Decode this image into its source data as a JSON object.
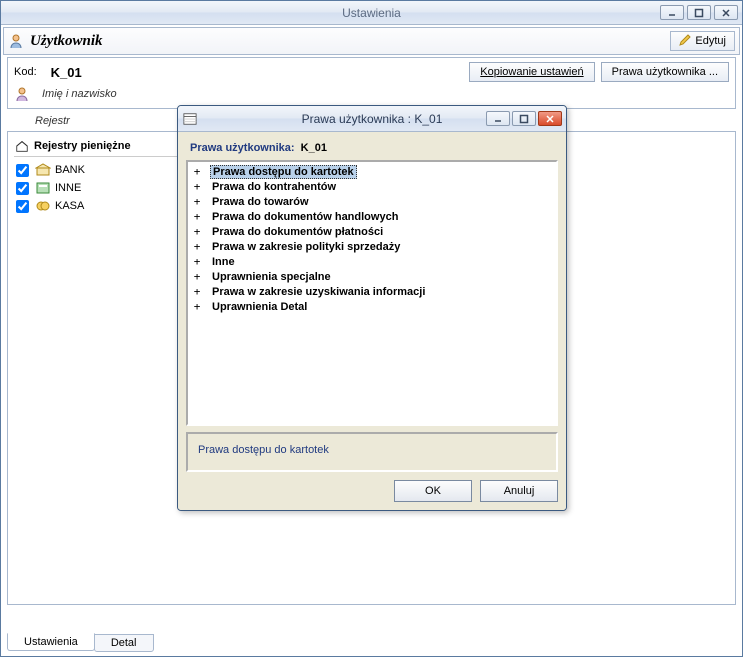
{
  "main": {
    "title": "Ustawienia",
    "user_section_label": "Użytkownik",
    "edit_button": "Edytuj"
  },
  "info": {
    "code_label": "Kod:",
    "code_value": "K_01",
    "fullname_label": "Imię i nazwisko",
    "copy_settings_button": "Kopiowanie ustawień",
    "user_rights_button": "Prawa użytkownika ..."
  },
  "registries": {
    "link_label": "Rejestr",
    "group_title": "Rejestry pieniężne",
    "items": [
      {
        "label": "BANK",
        "checked": true,
        "icon": "bank-icon"
      },
      {
        "label": "INNE",
        "checked": true,
        "icon": "other-icon"
      },
      {
        "label": "KASA",
        "checked": true,
        "icon": "cash-icon"
      }
    ]
  },
  "tabs": {
    "active": "Ustawienia",
    "items": [
      "Ustawienia",
      "Detal"
    ]
  },
  "dialog": {
    "title": "Prawa użytkownika : K_01",
    "subtitle_label": "Prawa użytkownika:",
    "subtitle_value": "K_01",
    "tree": [
      {
        "label": "Prawa dostępu do kartotek",
        "selected": true
      },
      {
        "label": "Prawa do kontrahentów"
      },
      {
        "label": "Prawa do towarów"
      },
      {
        "label": "Prawa do dokumentów handlowych"
      },
      {
        "label": "Prawa do dokumentów płatności"
      },
      {
        "label": "Prawa w zakresie polityki sprzedaży"
      },
      {
        "label": "Inne"
      },
      {
        "label": "Uprawnienia specjalne"
      },
      {
        "label": "Prawa w zakresie uzyskiwania informacji"
      },
      {
        "label": "Uprawnienia Detal"
      }
    ],
    "description": "Prawa dostępu do kartotek",
    "ok_button": "OK",
    "cancel_button": "Anuluj"
  },
  "colors": {
    "titlebar_text": "#5c6b82",
    "accent": "#203a80",
    "border": "#a8b8ce"
  }
}
